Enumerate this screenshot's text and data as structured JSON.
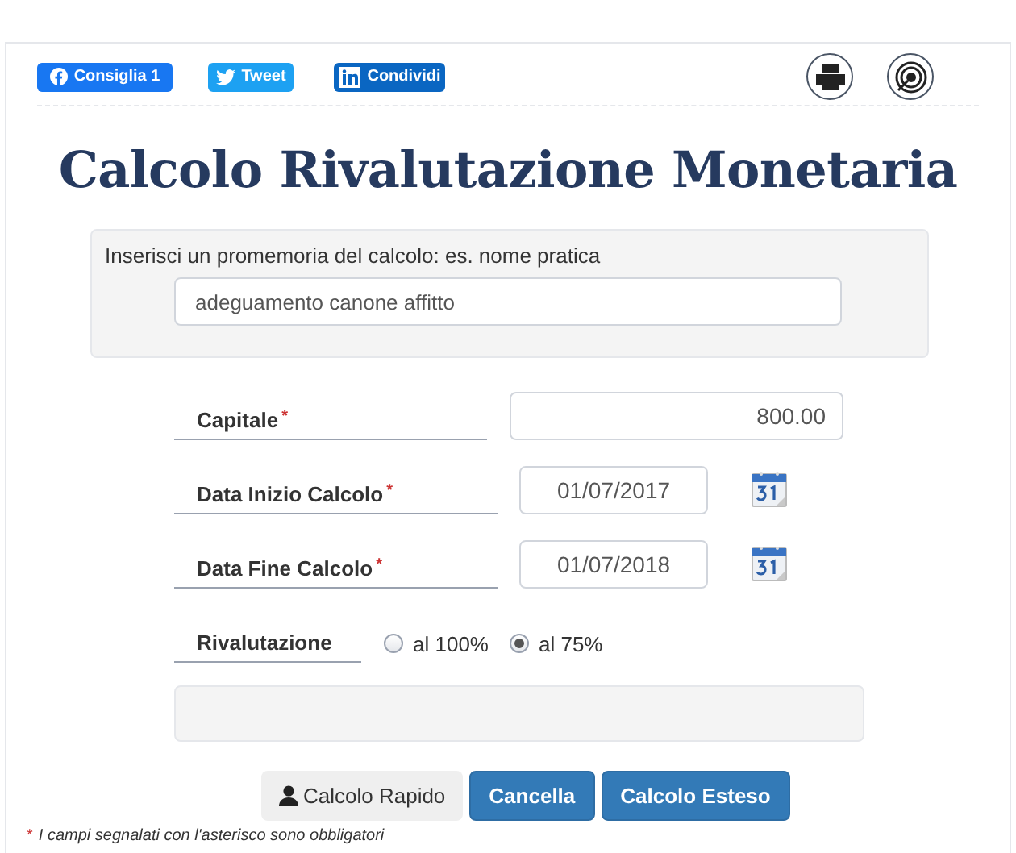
{
  "share_buttons": [
    {
      "kind": "facebook",
      "label": "Consiglia 1"
    },
    {
      "kind": "twitter",
      "label": "Tweet"
    },
    {
      "kind": "linkedin",
      "label": "Condividi"
    }
  ],
  "title": "Calcolo Rivalutazione Monetaria",
  "memo": {
    "label": "Inserisci un promemoria del calcolo: es. nome pratica",
    "value": "adeguamento canone affitto"
  },
  "fields": [
    {
      "kind": "number",
      "label": "Capitale",
      "marker": "*",
      "value": "800.00"
    },
    {
      "kind": "date",
      "label": "Data Inizio Calcolo",
      "marker": "*",
      "value": "01/07/2017"
    },
    {
      "kind": "date",
      "label": "Data Fine Calcolo",
      "marker": "*",
      "value": "01/07/2018"
    }
  ],
  "revaluation": {
    "label": "Rivalutazione",
    "options": [
      {
        "label": "al 100%",
        "selected": false
      },
      {
        "label": "al 75%",
        "selected": true
      }
    ]
  },
  "buttons": [
    {
      "kind": "default",
      "label": "Calcolo Rapido"
    },
    {
      "kind": "primary",
      "label": "Cancella"
    },
    {
      "kind": "primary",
      "label": "Calcolo Esteso"
    }
  ],
  "footnote": {
    "marker": "*",
    "text": "I campi segnalati con l'asterisco sono obbligatori"
  }
}
